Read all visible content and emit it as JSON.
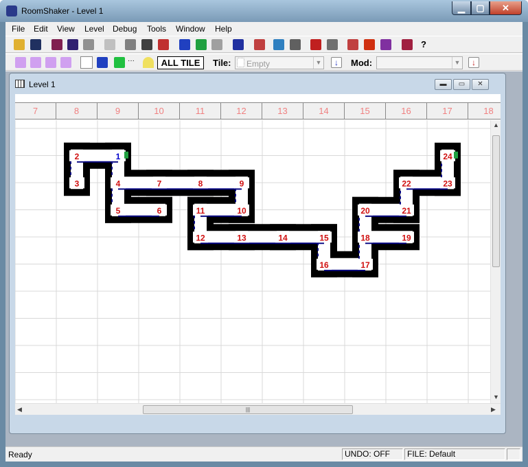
{
  "window": {
    "title": "RoomShaker - Level 1",
    "min": "▁",
    "max": "▢",
    "close": "✕"
  },
  "menu": [
    "File",
    "Edit",
    "View",
    "Level",
    "Debug",
    "Tools",
    "Window",
    "Help"
  ],
  "toolbar2": {
    "all_tile": "ALL TILE",
    "tile_label": "Tile:",
    "tile_value": "Empty",
    "mod_label": "Mod:",
    "mod_value": ""
  },
  "child": {
    "title": "Level 1"
  },
  "ruler": [
    "7",
    "8",
    "9",
    "10",
    "11",
    "12",
    "13",
    "14",
    "15",
    "16",
    "17",
    "18"
  ],
  "rooms": [
    {
      "n": "1",
      "r": 0,
      "c": 2
    },
    {
      "n": "2",
      "r": 0,
      "c": 1
    },
    {
      "n": "3",
      "r": 1,
      "c": 1
    },
    {
      "n": "4",
      "r": 1,
      "c": 2
    },
    {
      "n": "5",
      "r": 2,
      "c": 2
    },
    {
      "n": "6",
      "r": 2,
      "c": 3
    },
    {
      "n": "7",
      "r": 1,
      "c": 3
    },
    {
      "n": "8",
      "r": 1,
      "c": 4
    },
    {
      "n": "9",
      "r": 1,
      "c": 5
    },
    {
      "n": "10",
      "r": 2,
      "c": 5
    },
    {
      "n": "11",
      "r": 2,
      "c": 4
    },
    {
      "n": "12",
      "r": 3,
      "c": 4
    },
    {
      "n": "13",
      "r": 3,
      "c": 5
    },
    {
      "n": "14",
      "r": 3,
      "c": 6
    },
    {
      "n": "15",
      "r": 3,
      "c": 7
    },
    {
      "n": "16",
      "r": 4,
      "c": 7
    },
    {
      "n": "17",
      "r": 4,
      "c": 8
    },
    {
      "n": "18",
      "r": 3,
      "c": 8
    },
    {
      "n": "19",
      "r": 3,
      "c": 9
    },
    {
      "n": "20",
      "r": 2,
      "c": 8
    },
    {
      "n": "21",
      "r": 2,
      "c": 9
    },
    {
      "n": "22",
      "r": 1,
      "c": 9
    },
    {
      "n": "23",
      "r": 1,
      "c": 10
    },
    {
      "n": "24",
      "r": 0,
      "c": 10
    }
  ],
  "links": [
    [
      "2",
      "1"
    ],
    [
      "2",
      "3"
    ],
    [
      "1",
      "4"
    ],
    [
      "4",
      "7"
    ],
    [
      "7",
      "8"
    ],
    [
      "8",
      "9"
    ],
    [
      "9",
      "10"
    ],
    [
      "10",
      "11"
    ],
    [
      "4",
      "5"
    ],
    [
      "5",
      "6"
    ],
    [
      "11",
      "12"
    ],
    [
      "12",
      "13"
    ],
    [
      "13",
      "14"
    ],
    [
      "14",
      "15"
    ],
    [
      "15",
      "16"
    ],
    [
      "16",
      "17"
    ],
    [
      "17",
      "18"
    ],
    [
      "18",
      "19"
    ],
    [
      "18",
      "20"
    ],
    [
      "20",
      "21"
    ],
    [
      "21",
      "22"
    ],
    [
      "22",
      "23"
    ],
    [
      "23",
      "24"
    ]
  ],
  "start_rooms": [
    "1",
    "24"
  ],
  "colors": {
    "room_label": "#d01010",
    "start_label": "#0000cc",
    "connector": "#000080",
    "wall": "#000000",
    "grid": "#d8d8d8"
  },
  "status": {
    "ready": "Ready",
    "undo": "UNDO: OFF",
    "file": "FILE: Default"
  }
}
